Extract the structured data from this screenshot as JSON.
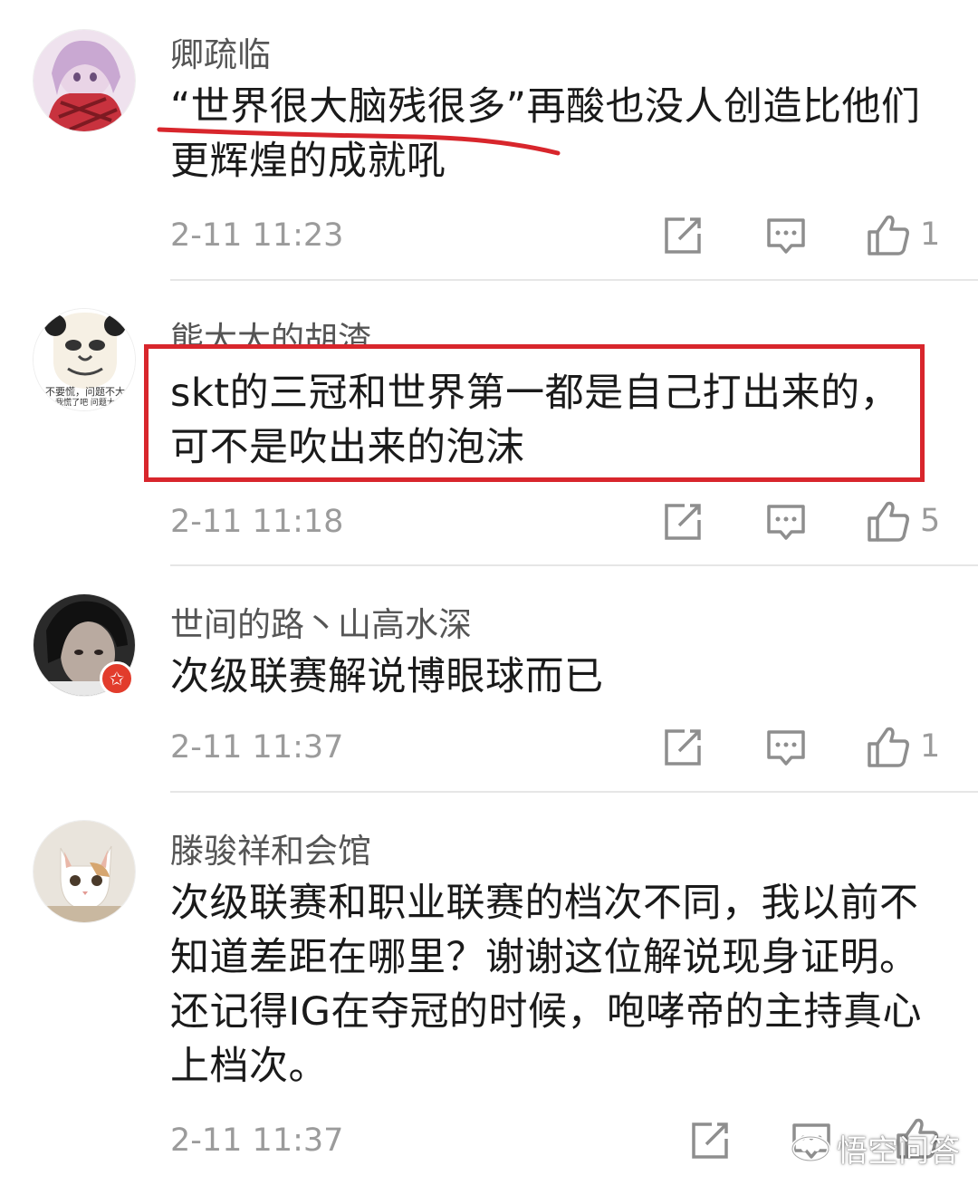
{
  "comments": [
    {
      "username": "卿疏临",
      "text_highlight": "“世界很大脑残很多”",
      "text_rest": "再酸也没人创造比他们更辉煌的成就吼",
      "time": "2-11 11:23",
      "likes": "1",
      "avatar_icon": "anime-girl-avatar-icon"
    },
    {
      "username": "熊大大的胡渣",
      "text": "skt的三冠和世界第一都是自己打出来的，可不是吹出来的泡沫",
      "time": "2-11 11:18",
      "likes": "5",
      "avatar_icon": "meme-face-avatar-icon",
      "avatar_caption_1": "不要慌，问题不大",
      "avatar_caption_2": "我慌了吧  问题大"
    },
    {
      "username": "世间的路丶山高水深",
      "text": "次级联赛解说博眼球而已",
      "time": "2-11 11:37",
      "likes": "1",
      "avatar_icon": "dark-portrait-avatar-icon"
    },
    {
      "username": "滕骏祥和会馆",
      "text": "次级联赛和职业联赛的档次不同，我以前不知道差距在哪里？谢谢这位解说现身证明。还记得IG在夺冠的时候，咆哮帝的主持真心上档次。",
      "time": "2-11 11:37",
      "likes": "",
      "avatar_icon": "cat-avatar-icon"
    }
  ],
  "watermark": "悟空问答",
  "colors": {
    "annotation_red": "#d8262c",
    "meta_gray": "#9b9b9b",
    "divider": "#e6e6e6"
  }
}
